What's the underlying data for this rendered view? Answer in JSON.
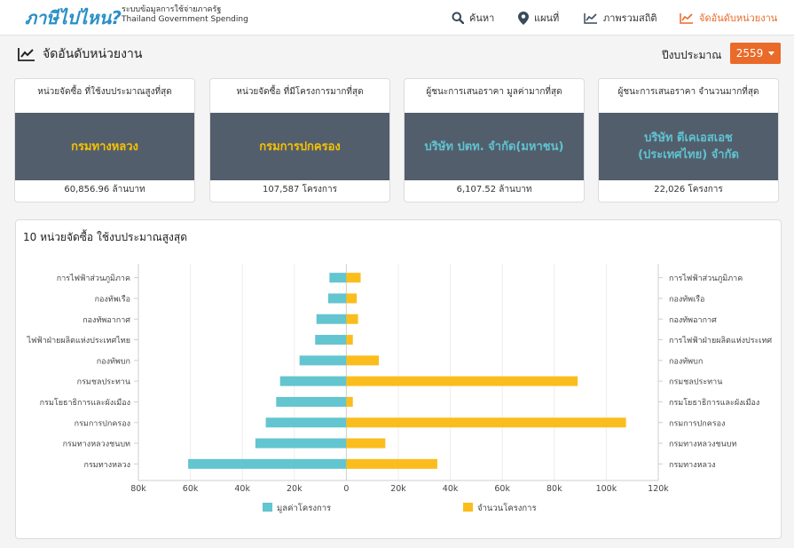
{
  "brand": {
    "title": "ภาษีไปไหน?",
    "sub_line1": "ระบบข้อมูลการใช้จ่ายภาครัฐ",
    "sub_line2": "Thailand Government Spending"
  },
  "nav": {
    "search": "ค้นหา",
    "map": "แผนที่",
    "overview": "ภาพรวมสถิติ",
    "ranking": "จัดอันดับหน่วยงาน"
  },
  "section_title": "จัดอันดับหน่วยงาน",
  "year": {
    "label": "ปีงบประมาณ",
    "value": "2559"
  },
  "cards": [
    {
      "title": "หน่วยจัดซื้อ ที่ใช้งบประมาณสูงที่สุด",
      "name": "กรมทางหลวง",
      "value": "60,856.96 ล้านบาท"
    },
    {
      "title": "หน่วยจัดซื้อ ที่มีโครงการมากที่สุด",
      "name": "กรมการปกครอง",
      "value": "107,587 โครงการ"
    },
    {
      "title": "ผู้ชนะการเสนอราคา มูลค่ามากที่สุด",
      "name": "บริษัท ปตท. จำกัด(มหาชน)",
      "value": "6,107.52 ล้านบาท"
    },
    {
      "title": "ผู้ชนะการเสนอราคา จำนวนมากที่สุด",
      "name": "บริษัท ดีเคเอสเอช (ประเทศไทย) จำกัด",
      "value": "22,026 โครงการ"
    }
  ],
  "colors": {
    "accent": "#ea6a2a",
    "teal": "#63c5cf",
    "yellow": "#fbbd1e",
    "card_bg": "#535e6c"
  },
  "chart_data": {
    "type": "bar",
    "title": "10 หน่วยจัดซื้อ ใช้งบประมาณสูงสุด",
    "categories_left": [
      "การไฟฟ้าส่วนภูมิภาค",
      "กองทัพเรือ",
      "กองทัพอากาศ",
      "ไฟฟ้าฝ่ายผลิตแห่งประเทศไทย",
      "กองทัพบก",
      "กรมชลประทาน",
      "กรมโยธาธิการและผังเมือง",
      "กรมการปกครอง",
      "กรมทางหลวงชนบท",
      "กรมทางหลวง"
    ],
    "categories_right": [
      "การไฟฟ้าส่วนภูมิภาค",
      "กองทัพเรือ",
      "กองทัพอากาศ",
      "การไฟฟ้าฝ่ายผลิตแห่งประเทศ",
      "กองทัพบก",
      "กรมชลประทาน",
      "กรมโยธาธิการและผังเมือง",
      "กรมการปกครอง",
      "กรมทางหลวงชนบท",
      "กรมทางหลวง"
    ],
    "series": [
      {
        "name": "มูลค่าโครงการ",
        "color": "#63c5cf",
        "values": [
          6500,
          7000,
          11500,
          12000,
          18000,
          25500,
          27000,
          31000,
          35000,
          60857
        ]
      },
      {
        "name": "จำนวนโครงการ",
        "color": "#fbbd1e",
        "values": [
          5500,
          4000,
          4500,
          2500,
          12500,
          89000,
          2500,
          107587,
          15000,
          35000
        ]
      }
    ],
    "xlim": [
      -80000,
      120000
    ],
    "xticks": [
      -80000,
      -60000,
      -40000,
      -20000,
      0,
      20000,
      40000,
      60000,
      80000,
      100000,
      120000
    ],
    "xtick_labels": [
      "80k",
      "60k",
      "40k",
      "20k",
      "0",
      "20k",
      "40k",
      "60k",
      "80k",
      "100k",
      "120k"
    ],
    "legend": "bottom",
    "grid": true
  }
}
